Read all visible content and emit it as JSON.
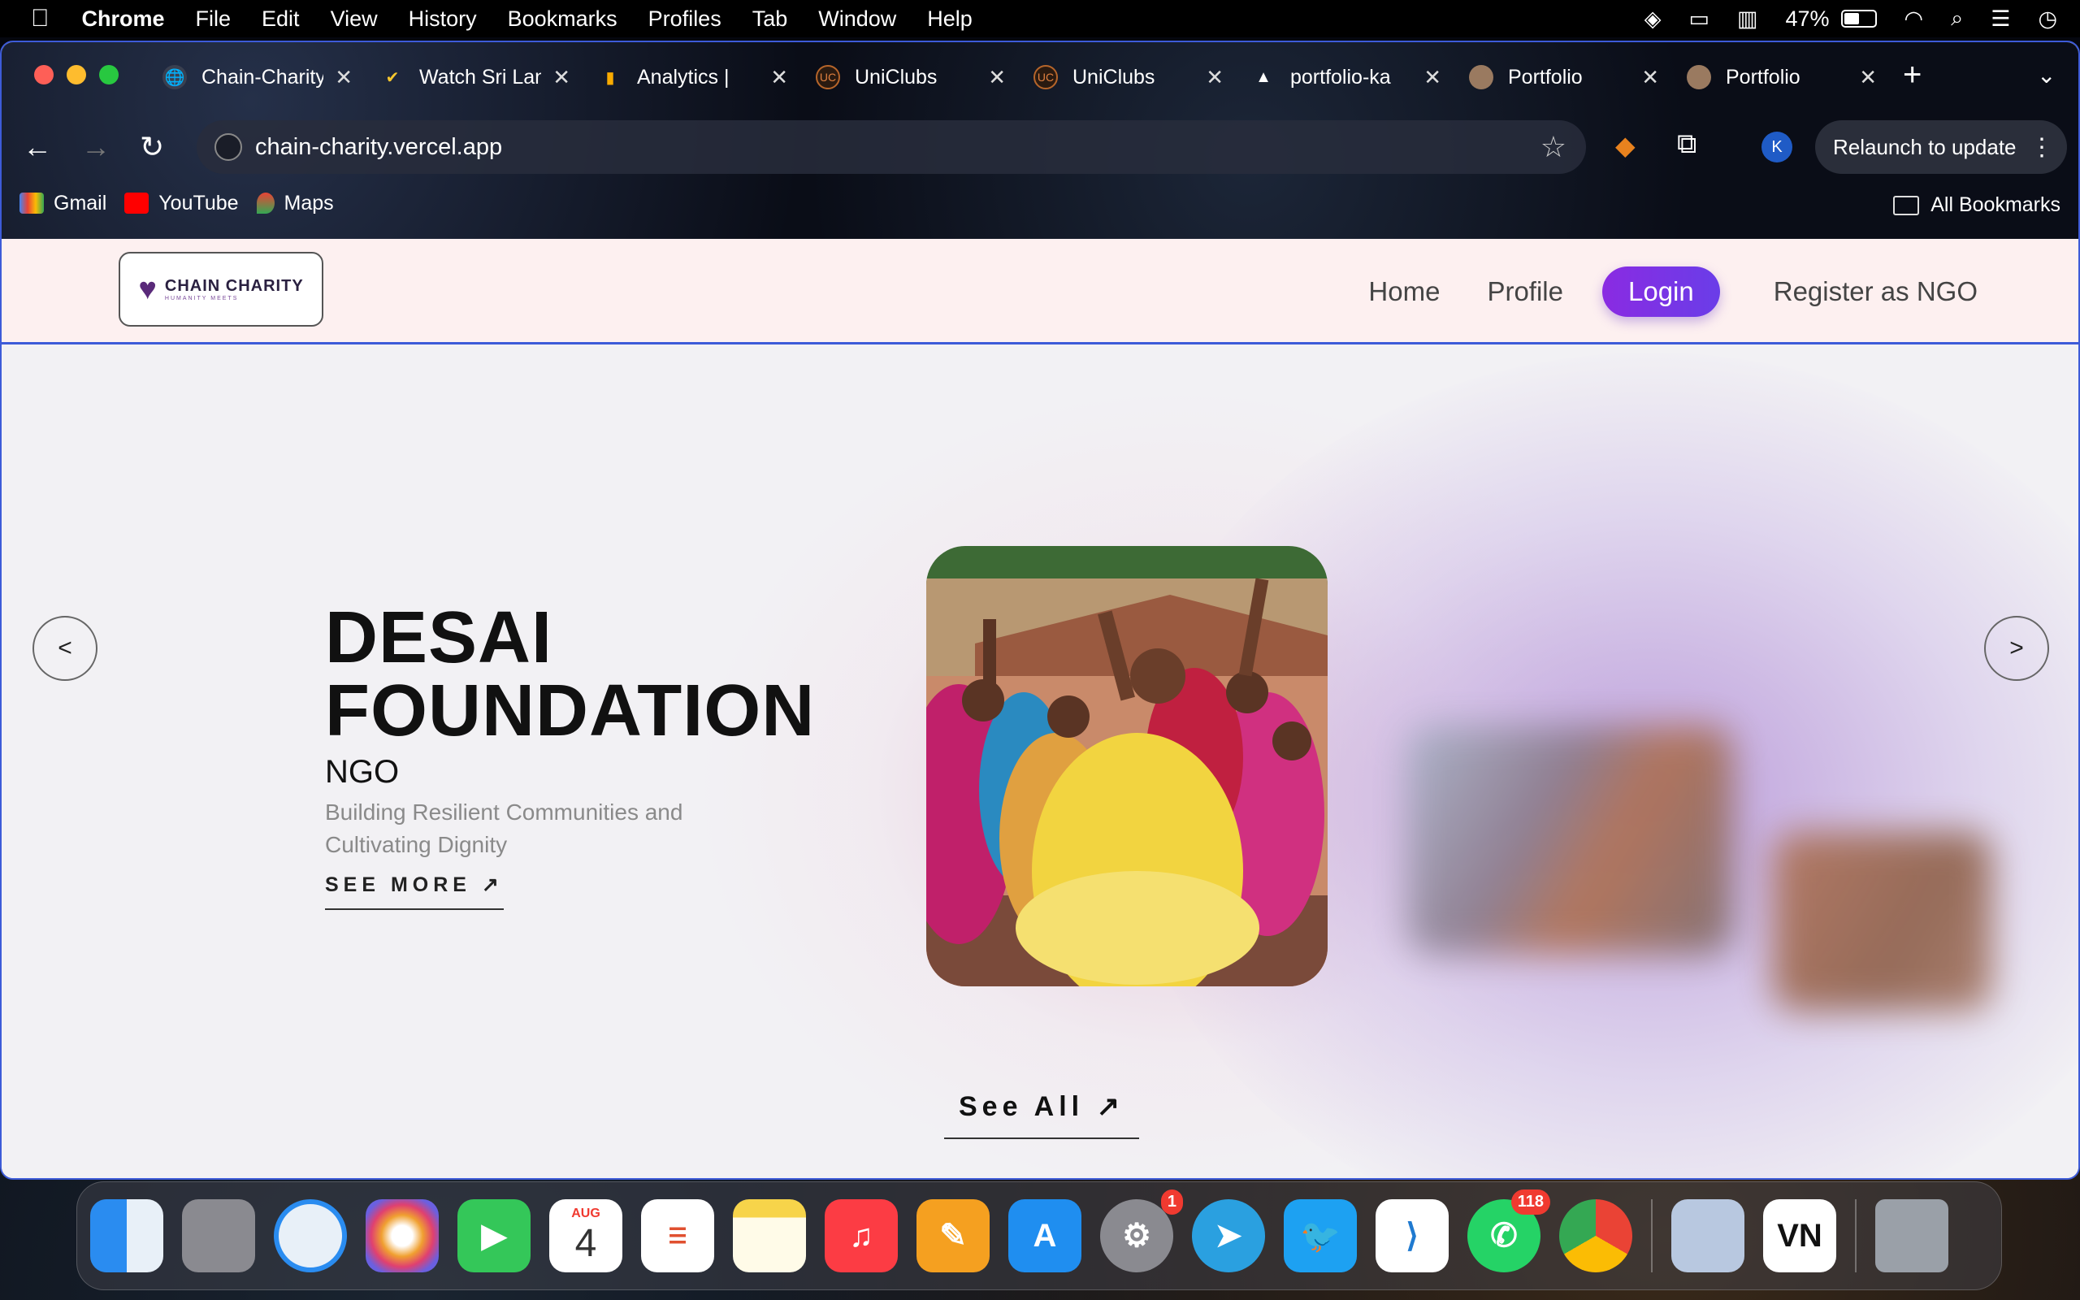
{
  "menubar": {
    "app": "Chrome",
    "items": [
      "File",
      "Edit",
      "View",
      "History",
      "Bookmarks",
      "Profiles",
      "Tab",
      "Window",
      "Help"
    ],
    "battery": "47%"
  },
  "tabs": [
    {
      "label": "Chain-Charity",
      "icon": "globe-icon"
    },
    {
      "label": "Watch Sri Lanka",
      "icon": "check-icon"
    },
    {
      "label": "Analytics | ",
      "icon": "analytics-icon"
    },
    {
      "label": "UniClubs",
      "icon": "uniclubs-icon"
    },
    {
      "label": "UniClubs",
      "icon": "uniclubs-icon"
    },
    {
      "label": "portfolio-ka",
      "icon": "vercel-icon"
    },
    {
      "label": "Portfolio",
      "icon": "avatar-icon"
    },
    {
      "label": "Portfolio",
      "icon": "avatar-icon"
    }
  ],
  "toolbar": {
    "url": "chain-charity.vercel.app",
    "profile_initial": "K",
    "relaunch_label": "Relaunch to update"
  },
  "bookmarks": [
    {
      "label": "Gmail",
      "icon": "gmail-icon"
    },
    {
      "label": "YouTube",
      "icon": "youtube-icon"
    },
    {
      "label": "Maps",
      "icon": "maps-icon"
    }
  ],
  "all_bookmarks": "All Bookmarks",
  "site": {
    "logo_text": "CHAIN CHARITY",
    "logo_sub": "HUMANITY MEETS",
    "nav": {
      "home": "Home",
      "profile": "Profile",
      "login": "Login",
      "register": "Register as NGO"
    },
    "prev": "<",
    "next": ">",
    "hero": {
      "title_line1": "DESAI",
      "title_line2": "FOUNDATION",
      "type": "NGO",
      "description": "Building Resilient Communities and Cultivating Dignity",
      "see_more": "SEE MORE ↗"
    },
    "see_all": "See All ↗"
  },
  "dock": {
    "calendar_month": "AUG",
    "calendar_day": "4",
    "settings_badge": "1",
    "whatsapp_badge": "118",
    "vn_label": "VN"
  }
}
